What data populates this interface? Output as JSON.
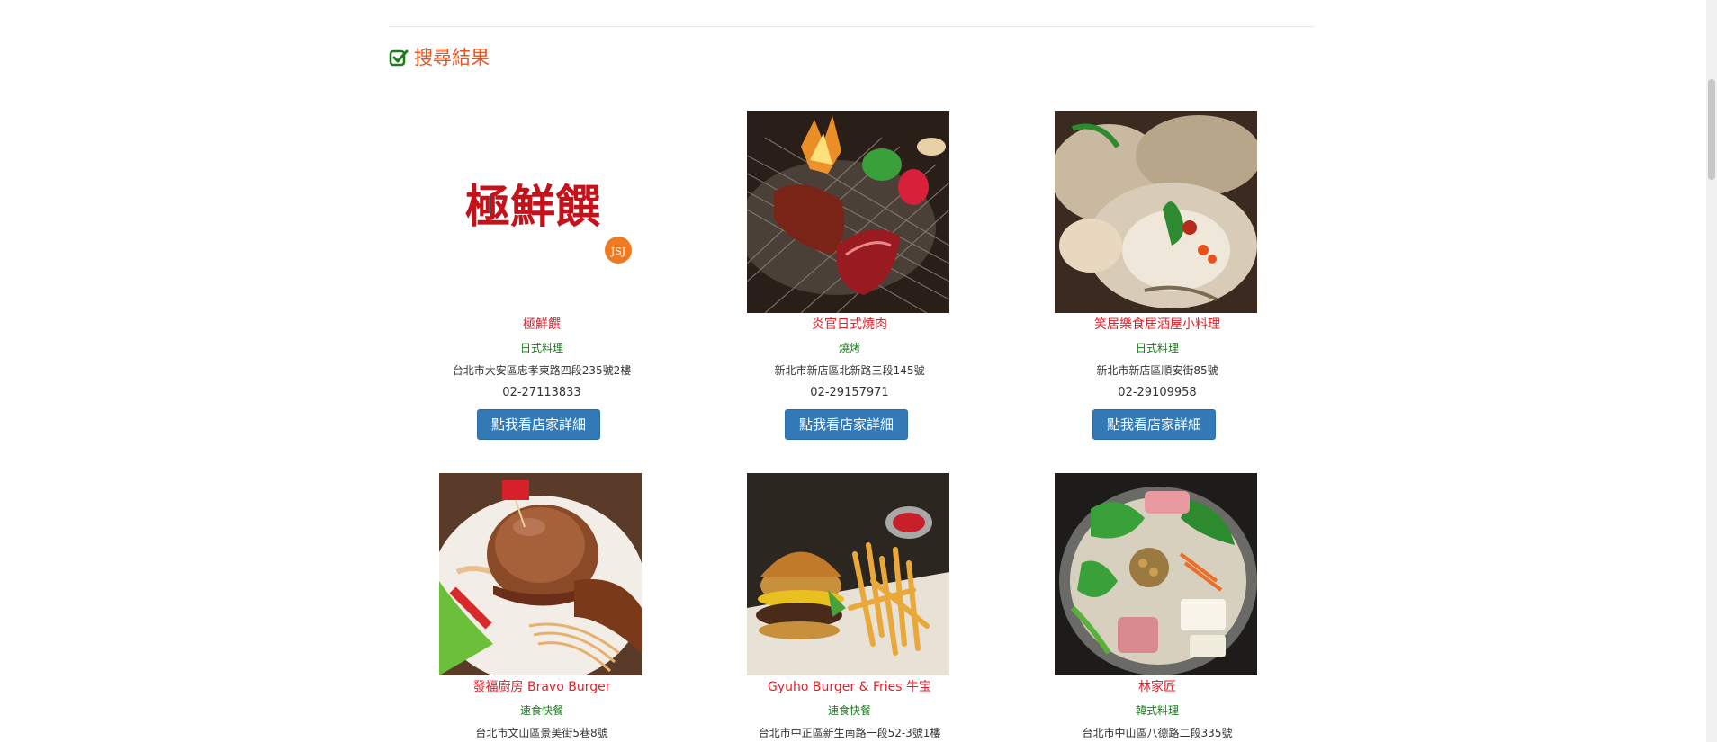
{
  "section": {
    "title": "搜尋結果",
    "icon": "checkbox-checked-icon",
    "accent": "#e8551f",
    "icon_color": "#1d7a1d"
  },
  "restaurants": [
    {
      "name": "極鮮饌",
      "category": "日式料理",
      "address": "台北市大安區忠孝東路四段235號2樓",
      "phone": "02-27113833",
      "button": "點我看店家詳細",
      "logo_text": "極鮮饌",
      "logo_badge": "JSJ"
    },
    {
      "name": "炎官日式燒肉",
      "category": "燒烤",
      "address": "新北市新店區北新路三段145號",
      "phone": "02-29157971",
      "button": "點我看店家詳細"
    },
    {
      "name": "笑居樂食居酒屋小料理",
      "category": "日式料理",
      "address": "新北市新店區順安街85號",
      "phone": "02-29109958",
      "button": "點我看店家詳細"
    },
    {
      "name": "發福廚房 Bravo Burger",
      "category": "速食快餐",
      "address": "台北市文山區景美街5巷8號"
    },
    {
      "name": "Gyuho Burger & Fries 牛宝",
      "category": "速食快餐",
      "address": "台北市中正區新生南路一段52-3號1樓"
    },
    {
      "name": "林家匠",
      "category": "韓式料理",
      "address": "台北市中山區八德路二段335號"
    }
  ]
}
